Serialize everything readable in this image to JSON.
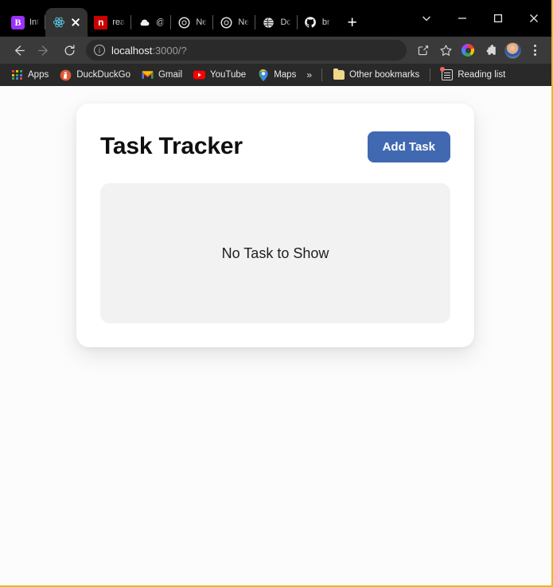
{
  "browser": {
    "tabs": [
      {
        "title": "Int",
        "icon": "bootstrap-icon",
        "icon_glyph": "B",
        "active": false
      },
      {
        "title": "",
        "icon": "react-icon",
        "icon_glyph": "",
        "active": true
      },
      {
        "title": "rea",
        "icon": "npm-icon",
        "icon_glyph": "n",
        "active": false
      },
      {
        "title": "@",
        "icon": "cloud-icon",
        "icon_glyph": "",
        "active": false
      },
      {
        "title": "Ne",
        "icon": "chrome-icon",
        "icon_glyph": "",
        "active": false
      },
      {
        "title": "Ne",
        "icon": "chrome-icon",
        "icon_glyph": "",
        "active": false
      },
      {
        "title": "Dc",
        "icon": "globe-icon",
        "icon_glyph": "",
        "active": false
      },
      {
        "title": "br",
        "icon": "github-icon",
        "icon_glyph": "",
        "active": false
      }
    ],
    "new_tab_label": "+",
    "window_controls": {
      "tab_search": "tab-search-chevron",
      "minimize": "minimize",
      "maximize": "maximize",
      "close": "close"
    },
    "toolbar": {
      "back_label": "Back",
      "forward_label": "Forward",
      "reload_label": "Reload",
      "site_info_glyph": "i",
      "url_host": "localhost",
      "url_rest": ":3000/?",
      "share_label": "Share this page",
      "bookmark_label": "Bookmark this tab",
      "extension_label": "Color extension",
      "extensions_label": "Extensions",
      "profile_label": "Profile",
      "menu_label": "Customize and control Google Chrome"
    },
    "bookmarks": {
      "items": [
        {
          "label": "Apps",
          "icon": "apps-grid-icon"
        },
        {
          "label": "DuckDuckGo",
          "icon": "duckduckgo-icon"
        },
        {
          "label": "Gmail",
          "icon": "gmail-icon"
        },
        {
          "label": "YouTube",
          "icon": "youtube-icon"
        },
        {
          "label": "Maps",
          "icon": "maps-pin-icon"
        }
      ],
      "overflow_label": "»",
      "other_bookmarks_label": "Other bookmarks",
      "reading_list_label": "Reading list"
    }
  },
  "page": {
    "title": "Task Tracker",
    "add_task_label": "Add Task",
    "empty_state": "No Task to Show",
    "colors": {
      "accent": "#4169b2",
      "card_bg": "#ffffff",
      "panel_bg": "#f2f2f2",
      "page_bg": "#fcfcfc",
      "title_color": "#0f0f0f"
    }
  }
}
